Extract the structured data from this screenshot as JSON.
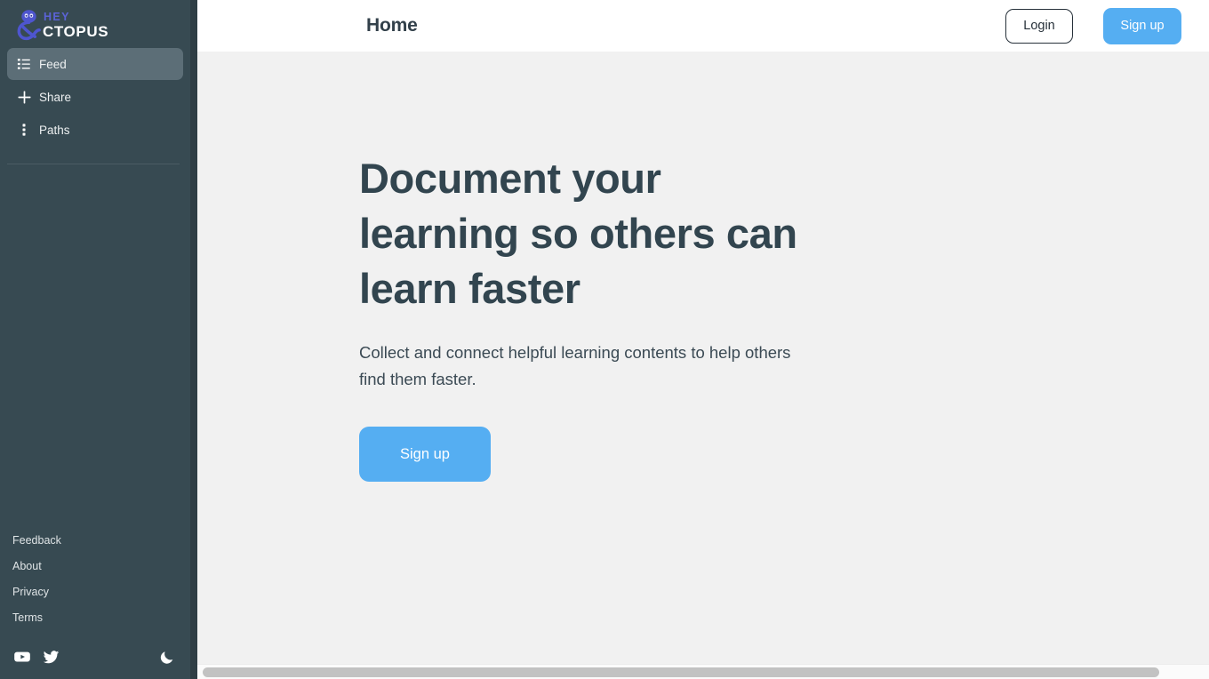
{
  "brand": {
    "logo_icon": "octopus-icon",
    "name_part1": "HEY",
    "name_part2": "CTOPUS",
    "accent_color": "#5b63d6"
  },
  "sidebar": {
    "background_color": "#374a52",
    "items": [
      {
        "label": "Feed",
        "icon": "list-icon",
        "active": true
      },
      {
        "label": "Share",
        "icon": "plus-icon",
        "active": false
      },
      {
        "label": "Paths",
        "icon": "dots-vertical-icon",
        "active": false
      }
    ],
    "footer_links": [
      {
        "label": "Feedback"
      },
      {
        "label": "About"
      },
      {
        "label": "Privacy"
      },
      {
        "label": "Terms"
      }
    ],
    "social": [
      {
        "icon": "youtube-icon",
        "label": "YouTube"
      },
      {
        "icon": "twitter-icon",
        "label": "Twitter"
      }
    ],
    "theme_toggle": {
      "icon": "moon-icon",
      "label": "Dark mode"
    }
  },
  "header": {
    "title": "Home",
    "login_label": "Login",
    "signup_label": "Sign up",
    "signup_color": "#55aef2"
  },
  "hero": {
    "title": "Document your learning so others can learn faster",
    "subtitle": "Collect and connect helpful learning contents to help others find them faster.",
    "cta_label": "Sign up",
    "cta_color": "#55aef2",
    "title_color": "#32454f"
  },
  "scrollbar": {
    "orientation": "horizontal",
    "thumb_color": "#c2c2c2"
  }
}
